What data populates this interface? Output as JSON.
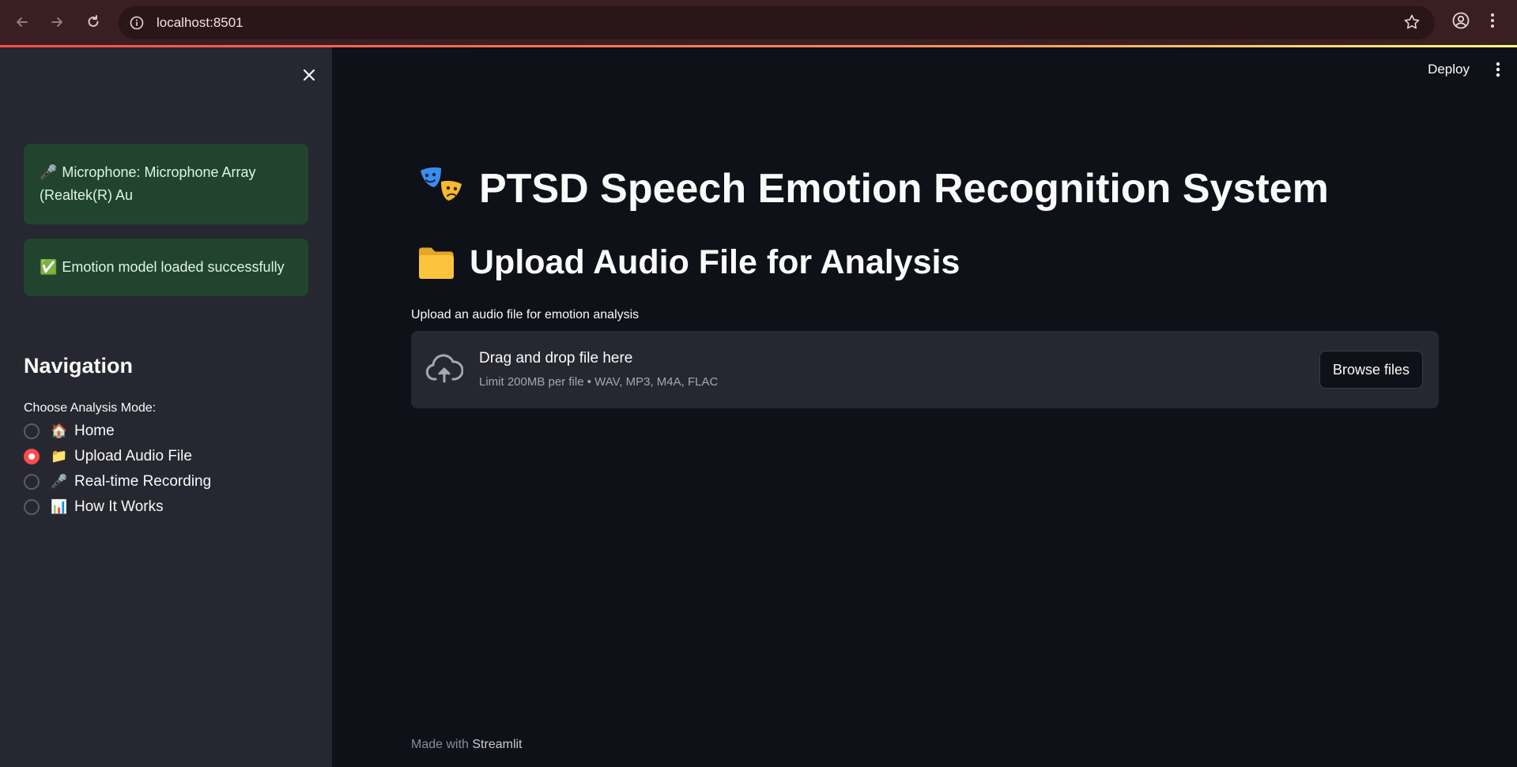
{
  "browser": {
    "url": "localhost:8501"
  },
  "sidebar": {
    "alerts": [
      {
        "icon": "microphone-icon",
        "emoji": "🎤",
        "text": "Microphone: Microphone Array (Realtek(R) Au"
      },
      {
        "icon": "check-icon",
        "emoji": "✅",
        "text": "Emotion model loaded successfully"
      }
    ],
    "nav_title": "Navigation",
    "mode_label": "Choose Analysis Mode:",
    "modes": [
      {
        "emoji": "🏠",
        "label": "Home",
        "selected": false
      },
      {
        "emoji": "📁",
        "label": "Upload Audio File",
        "selected": true
      },
      {
        "emoji": "🎤",
        "label": "Real-time Recording",
        "selected": false
      },
      {
        "emoji": "📊",
        "label": "How It Works",
        "selected": false
      }
    ]
  },
  "header": {
    "deploy_label": "Deploy"
  },
  "main": {
    "title": "PTSD Speech Emotion Recognition System",
    "subtitle": "Upload Audio File for Analysis",
    "upload_label": "Upload an audio file for emotion analysis",
    "dropzone": {
      "main_text": "Drag and drop file here",
      "limit_text": "Limit 200MB per file • WAV, MP3, M4A, FLAC",
      "browse_label": "Browse files"
    }
  },
  "footer": {
    "prefix": "Made with",
    "brand": "Streamlit"
  },
  "colors": {
    "accent": "#ff4b4b",
    "sidebar_bg": "#262730",
    "main_bg": "#0e1117",
    "success_bg": "#22442f"
  }
}
